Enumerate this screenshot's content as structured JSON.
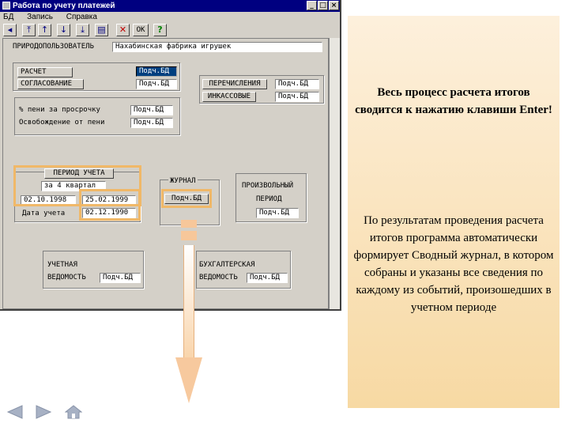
{
  "window": {
    "title": "Работа по учету платежей",
    "menu": [
      "БД",
      "Запись",
      "Справка"
    ],
    "toolbar_ok": "OK"
  },
  "form": {
    "nature_user_label": "ПРИРОДОПОЛЬЗОВАТЕЛЬ",
    "nature_user_value": "Нахабинская фабрика игрушек",
    "calc_btn": "РАСЧЕТ",
    "calc_field": "Подч.БД",
    "agree_btn": "СОГЛАСОВАНИЕ",
    "agree_field": "Подч.БД",
    "transfer_btn": "ПЕРЕЧИСЛЕНИЯ",
    "transfer_field": "Подч.БД",
    "collection_btn": "ИНКАССОВЫЕ",
    "collection_field": "Подч.БД",
    "penalty_label": "% пени за просрочку",
    "penalty_field": "Подч.БД",
    "exempt_label": "Освобождение от пени",
    "exempt_field": "Подч.БД",
    "period_title": "ПЕРИОД УЧЕТА",
    "period_value": "за 4 квартал",
    "date_from": "02.10.1998",
    "date_to": "25.02.1999",
    "account_date_label": "Дата учета",
    "account_date": "02.12.1990",
    "journal_title": "ЖУРНАЛ",
    "journal_field": "Подч.БД",
    "arbitrary_title_1": "ПРОИЗВОЛЬНЫЙ",
    "arbitrary_title_2": "ПЕРИОД",
    "arbitrary_field": "Подч.БД",
    "ledger_label_1": "УЧЕТНАЯ",
    "ledger_label_2": "ВЕДОМОСТЬ",
    "ledger_field": "Подч.БД",
    "acc_label_1": "БУХГАЛТЕРСКАЯ",
    "acc_label_2": "ВЕДОМОСТЬ",
    "acc_field": "Подч.БД"
  },
  "panel": {
    "bold_text": "Весь процесс расчета итогов сводится к нажатию клавиши Enter!",
    "body_text": "По результатам проведения расчета итогов программа автоматически формирует Сводный журнал, в котором собраны и указаны все сведения по каждому из событий, произошедших в учетном периоде"
  },
  "icons": [
    "left-arrow-icon",
    "right-arrow-icon",
    "home-icon"
  ],
  "colors": {
    "titlebar": "#000080",
    "panel": "#f7d9a3",
    "highlight": "#f0b868",
    "selected_field": "#003f7f"
  }
}
